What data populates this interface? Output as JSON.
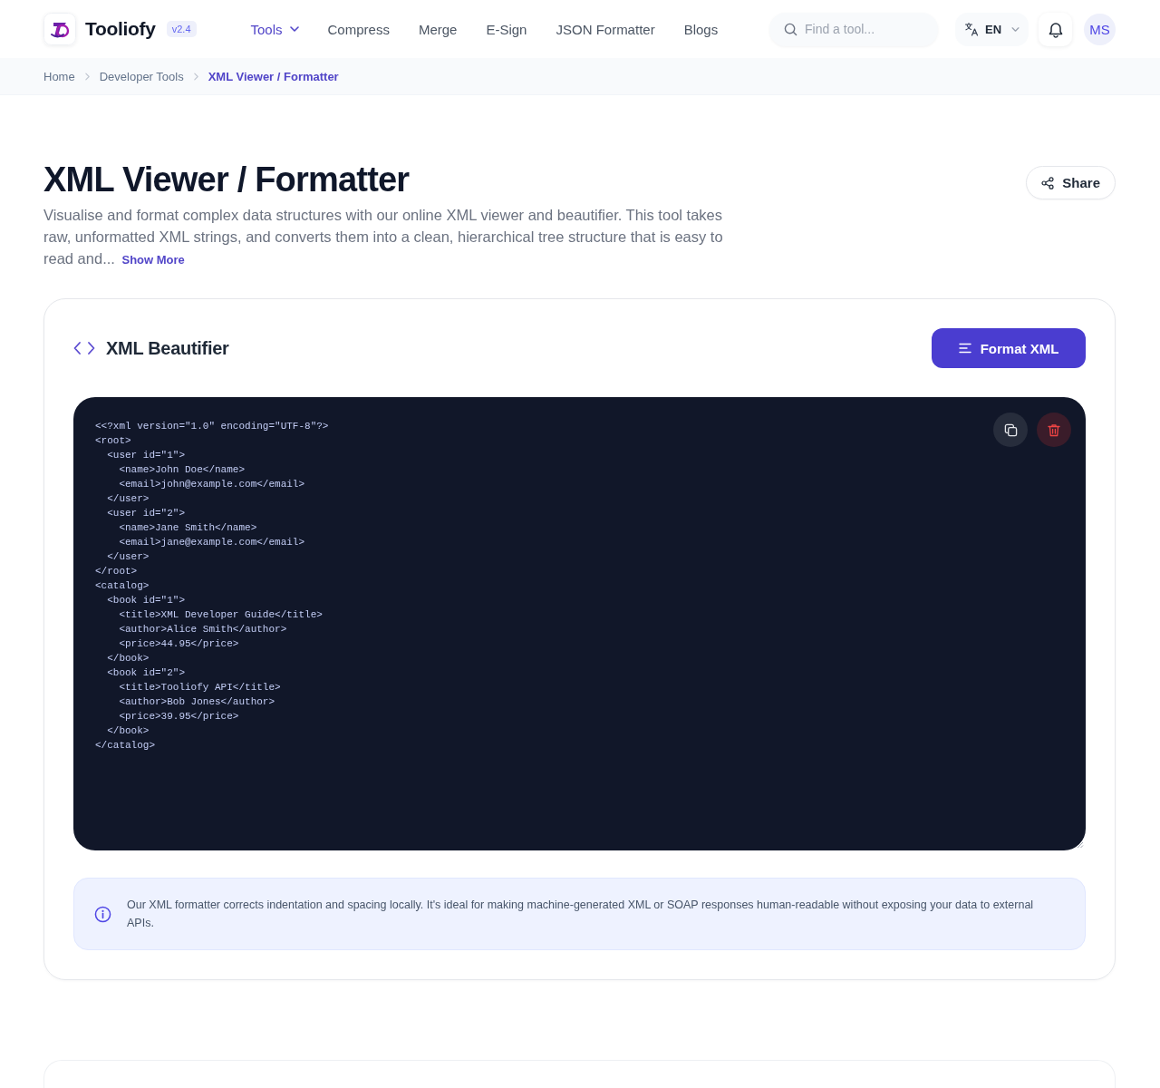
{
  "header": {
    "brand": {
      "name": "Tooliofy",
      "version": "v2.4"
    },
    "nav": [
      {
        "label": "Tools",
        "selected": true,
        "has_menu": true
      },
      {
        "label": "Compress",
        "selected": false,
        "has_menu": false
      },
      {
        "label": "Merge",
        "selected": false,
        "has_menu": false
      },
      {
        "label": "E-Sign",
        "selected": false,
        "has_menu": false
      },
      {
        "label": "JSON Formatter",
        "selected": false,
        "has_menu": false
      },
      {
        "label": "Blogs",
        "selected": false,
        "has_menu": false
      }
    ],
    "search": {
      "placeholder": "Find a tool..."
    },
    "language": "EN",
    "avatar": "MS"
  },
  "breadcrumb": [
    {
      "label": "Home",
      "selected": false
    },
    {
      "label": "Developer Tools",
      "selected": false
    },
    {
      "label": "XML Viewer / Formatter",
      "selected": true
    }
  ],
  "page": {
    "title": "XML Viewer / Formatter",
    "description": "Visualise and format complex data structures with our online XML viewer and beautifier. This tool takes raw, unformatted XML strings, and converts them into a clean, hierarchical tree structure that is easy to read and...",
    "show_more": "Show More",
    "share": "Share"
  },
  "tool": {
    "title": "XML Beautifier",
    "action": "Format XML",
    "code_lines": [
      "<<?xml version=\"1.0\" encoding=\"UTF-8\"?>",
      "<root>",
      "  <user id=\"1\">",
      "    <name>John Doe</name>",
      "    <email>john@example.com</email>",
      "  </user>",
      "  <user id=\"2\">",
      "    <name>Jane Smith</name>",
      "    <email>jane@example.com</email>",
      "  </user>",
      "</root>",
      "<catalog>",
      "  <book id=\"1\">",
      "    <title>XML Developer Guide</title>",
      "    <author>Alice Smith</author>",
      "    <price>44.95</price>",
      "  </book>",
      "  <book id=\"2\">",
      "    <title>Tooliofy API</title>",
      "    <author>Bob Jones</author>",
      "    <price>39.95</price>",
      "  </book>",
      "</catalog>"
    ],
    "info": "Our XML formatter corrects indentation and spacing locally. It's ideal for making machine-generated XML or SOAP responses human-readable without exposing your data to external APIs."
  }
}
